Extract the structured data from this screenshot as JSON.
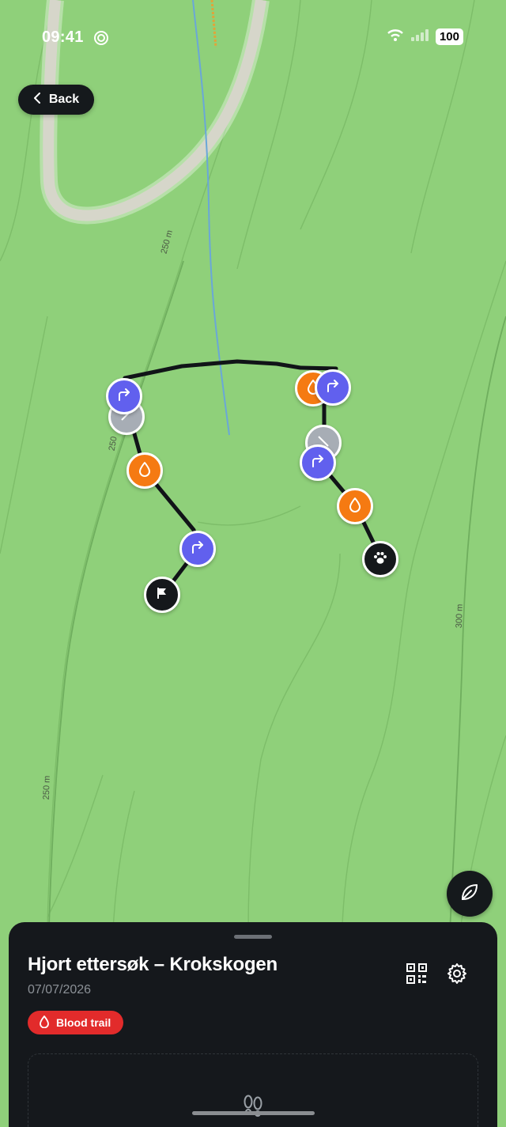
{
  "status_bar": {
    "time": "09:41",
    "battery": "100"
  },
  "nav": {
    "back_label": "Back"
  },
  "map": {
    "contour_labels": [
      "250 m",
      "250",
      "300 m",
      "250 m"
    ]
  },
  "sheet": {
    "title": "Hjort ettersøk – Krokskogen",
    "date": "07/07/2026",
    "status_badge": "Blood trail"
  },
  "colors": {
    "map_green": "#8fd07a",
    "route_line": "#111418",
    "turn_marker": "#6160ee",
    "blood_marker": "#f57a12",
    "badge_red": "#e22b2b",
    "sheet_bg": "#15181c"
  },
  "icons": [
    "focus-icon",
    "wifi-icon",
    "signal-icon",
    "chevron-left-icon",
    "turn-right-icon",
    "blood-drop-icon",
    "no-trail-icon",
    "paw-icon",
    "flag-icon",
    "leaf-icon",
    "qr-code-icon",
    "gear-icon",
    "footprints-icon"
  ]
}
